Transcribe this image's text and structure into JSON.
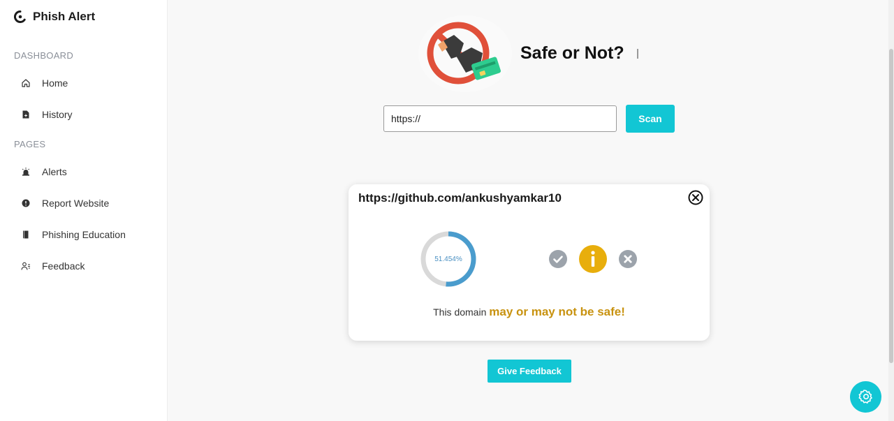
{
  "app": {
    "name": "Phish Alert"
  },
  "sidebar": {
    "sections": [
      {
        "label": "DASHBOARD"
      },
      {
        "label": "PAGES"
      }
    ],
    "items": [
      {
        "label": "Home",
        "icon": "home-icon"
      },
      {
        "label": "History",
        "icon": "history-icon"
      },
      {
        "label": "Alerts",
        "icon": "alarm-icon"
      },
      {
        "label": "Report Website",
        "icon": "alert-circle-icon"
      },
      {
        "label": "Phishing Education",
        "icon": "book-icon"
      },
      {
        "label": "Feedback",
        "icon": "user-feedback-icon"
      }
    ]
  },
  "hero": {
    "title": "Safe or Not?",
    "image": "no-phishing-illustration"
  },
  "scan": {
    "input_value": "https://",
    "button_label": "Scan"
  },
  "result": {
    "url": "https://github.com/ankushyamkar10",
    "score_label": "51.454%",
    "score_fraction": 0.51454,
    "verdict_prefix": "This domain ",
    "verdict_strong": "may or may not be safe!",
    "active_status": "info"
  },
  "feedback": {
    "button_label": "Give Feedback"
  },
  "colors": {
    "accent": "#12c6d4",
    "warning": "#e8ae0c",
    "verdict_text": "#c8920f",
    "donut_fill": "#4a9ccd",
    "donut_track": "#d9d9d9",
    "inactive_icon": "#9ca3ab"
  }
}
